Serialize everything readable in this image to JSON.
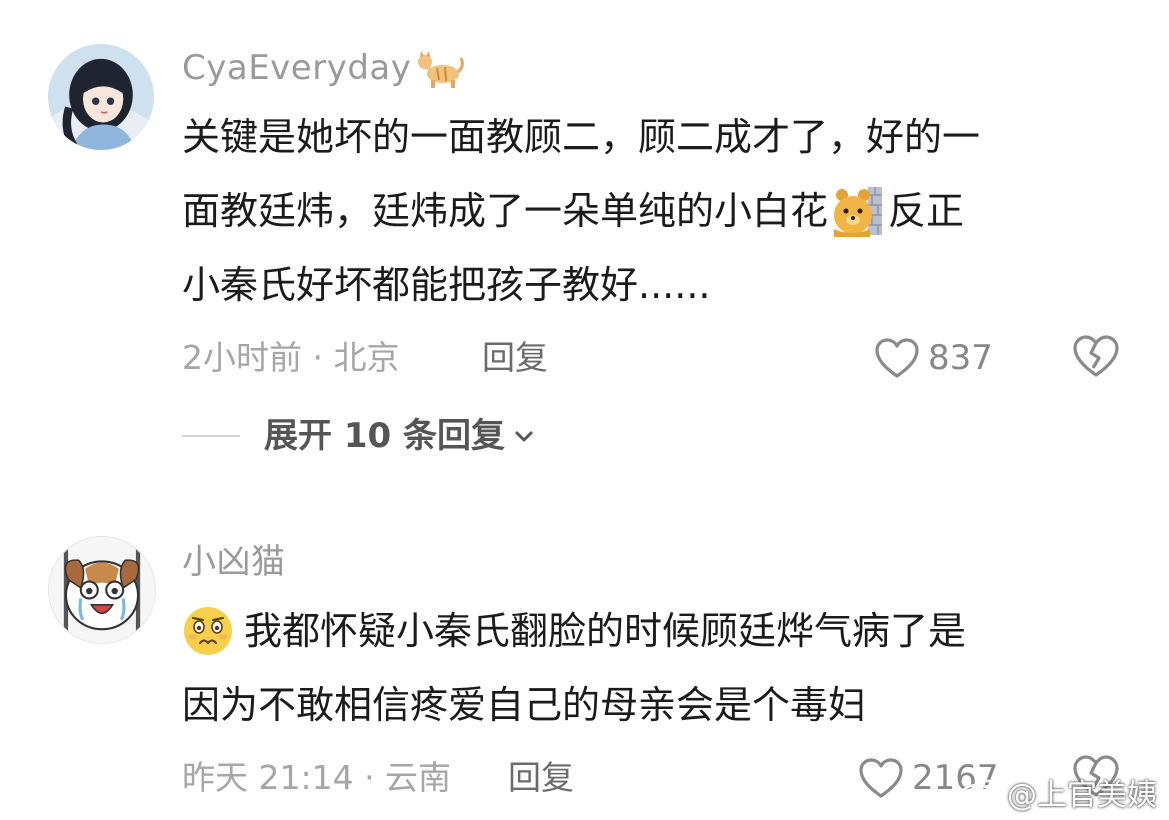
{
  "comments": [
    {
      "username": "CyaEveryday",
      "name_emoji": "cat-emoji",
      "lines": [
        "关键是她坏的一面教顾二，顾二成才了，好的一",
        "面教廷炜，廷炜成了一朵单纯的小白花",
        "反正",
        "小秦氏好坏都能把孩子教好......"
      ],
      "inline_emoji": "bear-peeking-emoji",
      "meta": "2小时前 · 北京",
      "reply_label": "回复",
      "likes": "837",
      "expand_label": "展开 10 条回复"
    },
    {
      "username": "小凶猫",
      "lead_emoji": "confused-face-emoji",
      "lines": [
        "我都怀疑小秦氏翻脸的时候顾廷烨气病了是",
        "因为不敢相信疼爱自己的母亲会是个毒妇"
      ],
      "meta": "昨天 21:14 · 云南",
      "reply_label": "回复",
      "likes": "2167"
    }
  ],
  "watermark": "@上官美姨",
  "colors": {
    "meta": "#a6a6a6",
    "username": "#9a9a9a",
    "text": "#1b1b1b"
  }
}
